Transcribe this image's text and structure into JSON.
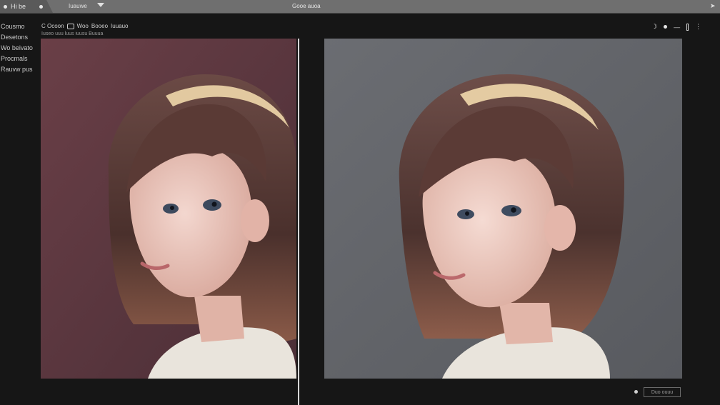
{
  "titlebar": {
    "tab_label": "Hi be",
    "menu_label": "Iuauwe",
    "window_title": "Gooe auoa"
  },
  "sidebar": {
    "items": [
      {
        "label": "Cousmo"
      },
      {
        "label": "Desetons"
      },
      {
        "label": "Wo beivato"
      },
      {
        "label": "Procmals"
      },
      {
        "label": "Rauvw pus"
      }
    ]
  },
  "breadcrumb": {
    "back_label": "C Ocoon",
    "items": [
      "Woo",
      "Booeo",
      "Iuuauo"
    ],
    "sub_text": "Iuseo uuu luus iuusu Buuua"
  },
  "canvas": {
    "left_bg": [
      "#6a3f47",
      "#4a2e36"
    ],
    "right_bg": [
      "#6b6d72",
      "#585a5f"
    ]
  },
  "footer": {
    "box_label": "Duo ouuu"
  }
}
